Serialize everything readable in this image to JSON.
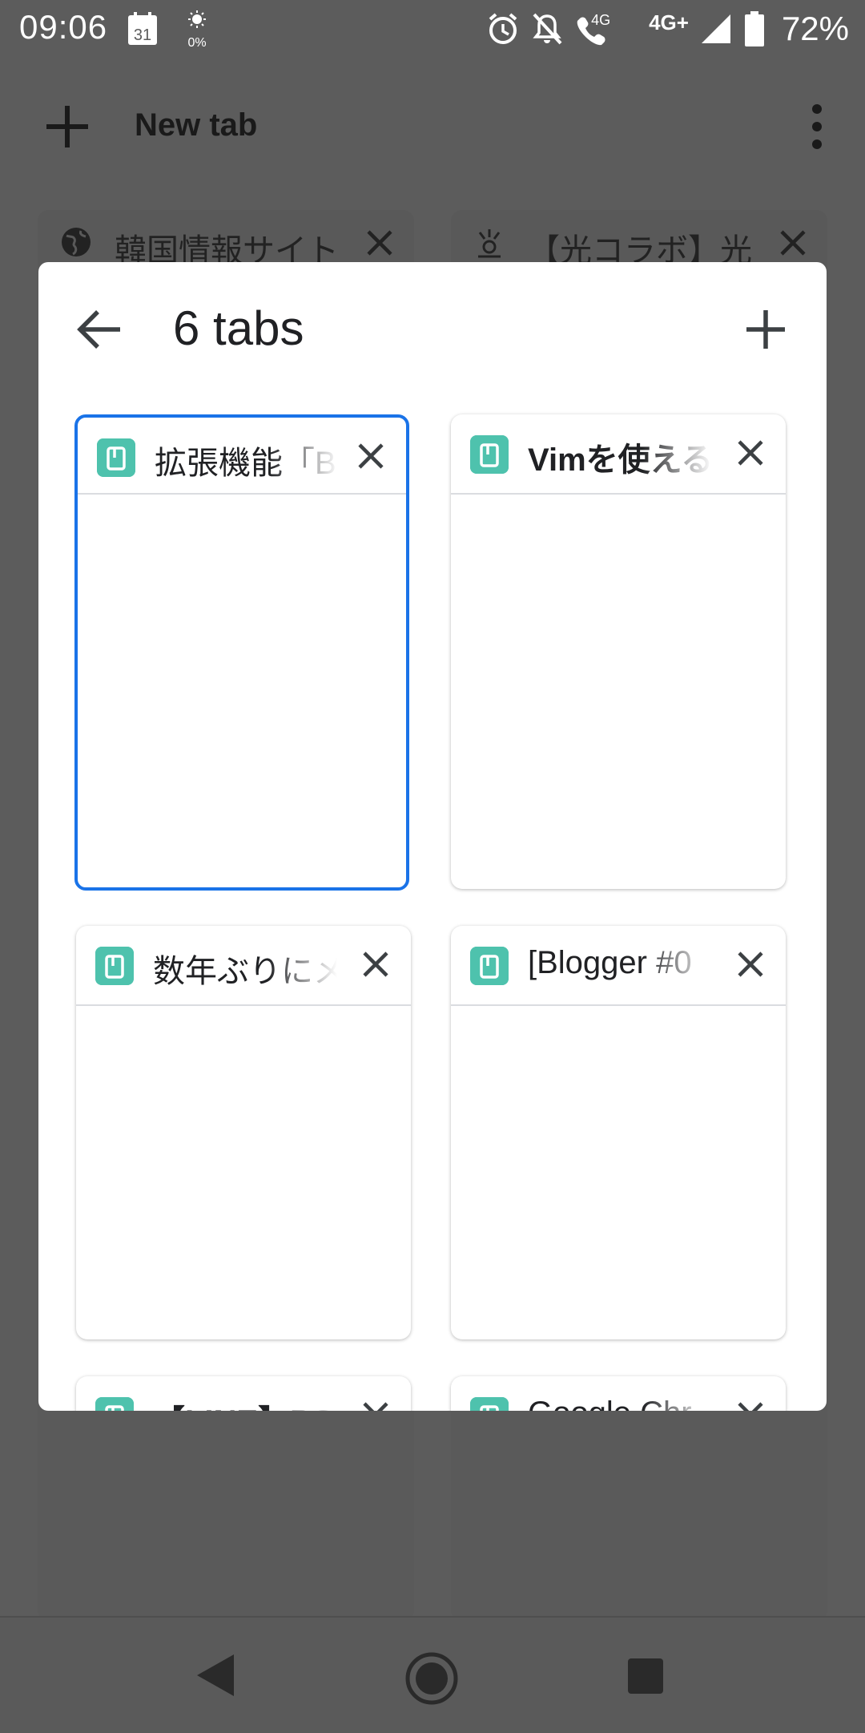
{
  "status_bar": {
    "time": "09:06",
    "calendar_day": "31",
    "brightness": "0%",
    "network": "4G",
    "network_plus": "4G+",
    "battery": "72%"
  },
  "toolbar": {
    "title": "New tab"
  },
  "background_tabs": [
    {
      "title": "韓国情報サイト"
    },
    {
      "title": "【光コラボ】光"
    }
  ],
  "dialog": {
    "title": "6 tabs"
  },
  "tabs": [
    {
      "title": "拡張機能「B",
      "selected": true
    },
    {
      "title": "Vimを使える",
      "selected": false
    },
    {
      "title": "数年ぶりにメ",
      "selected": false
    },
    {
      "title": "[Blogger #0",
      "selected": false
    },
    {
      "title": "【LINE】PC",
      "selected": false
    },
    {
      "title": "Google Chr",
      "selected": false
    }
  ],
  "colors": {
    "selected_border": "#1a73e8",
    "favicon": "#4ec2ad",
    "scrim": "#5c5c5c"
  }
}
